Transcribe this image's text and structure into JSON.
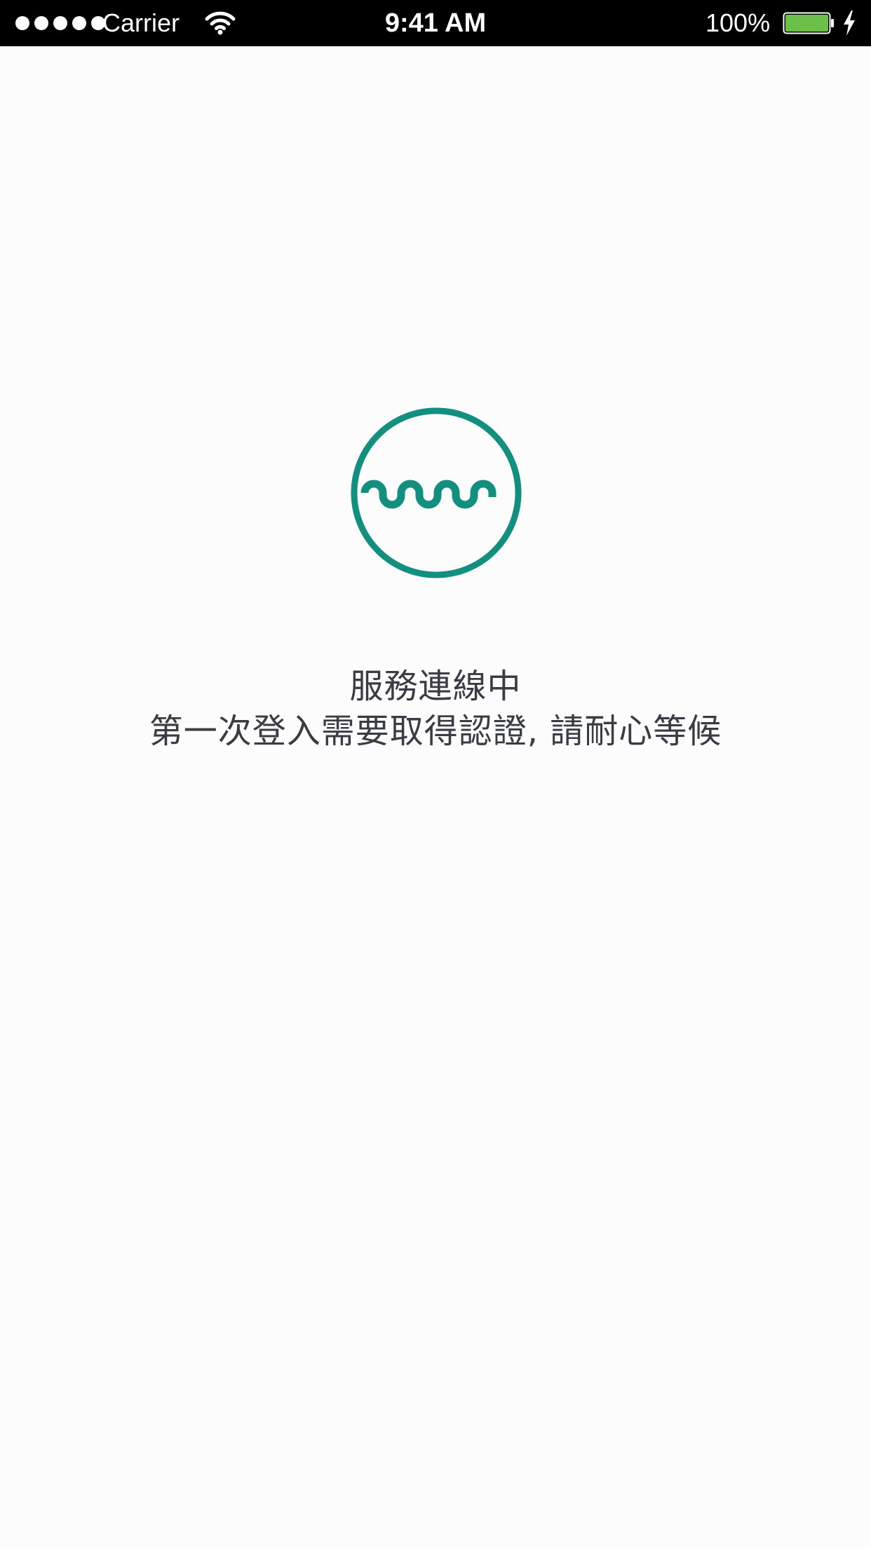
{
  "status_bar": {
    "carrier": "Carrier",
    "time": "9:41 AM",
    "battery_percent": "100%",
    "signal_bars": 5,
    "icons": [
      "signal-dots-icon",
      "wifi-icon",
      "battery-icon",
      "charging-bolt-icon"
    ],
    "battery_color": "#6cc04a"
  },
  "loading_screen": {
    "logo_icon": "wave-circle-logo-icon",
    "logo_color": "#138f80",
    "status_message": "服務連線中",
    "detail_message": "第一次登入需要取得認證, 請耐心等候"
  },
  "colors": {
    "background": "#fcfcfd",
    "text": "#3a3b45",
    "status_bar_background": "#000000"
  }
}
